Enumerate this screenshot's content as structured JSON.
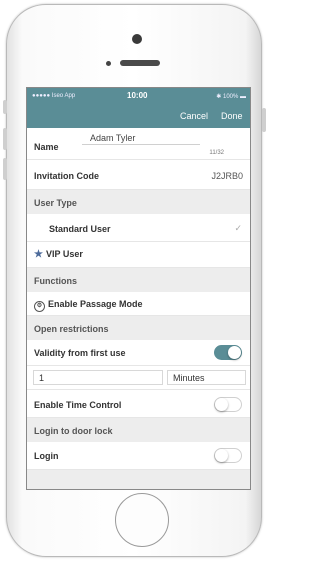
{
  "status_bar": {
    "carrier": "●●●●● Iseo App",
    "time": "10:00",
    "battery": "✱ 100% ▬"
  },
  "navbar": {
    "cancel": "Cancel",
    "done": "Done"
  },
  "name": {
    "label": "Name",
    "value": "Adam Tyler",
    "counter": "11/32"
  },
  "invitation": {
    "label": "Invitation Code",
    "value": "J2JRB0"
  },
  "user_type": {
    "header": "User Type",
    "standard": "Standard User",
    "check": "✓",
    "vip": "VIP User"
  },
  "functions": {
    "header": "Functions",
    "passage_mode": "Enable Passage Mode"
  },
  "open_restrictions": {
    "header": "Open restrictions",
    "validity_label": "Validity from first use",
    "validity_on": true,
    "duration_value": "1",
    "duration_unit": "Minutes",
    "time_control_label": "Enable Time Control",
    "time_control_on": false
  },
  "door_lock": {
    "header": "Login to door lock",
    "login_label": "Login",
    "login_on": false
  },
  "colors": {
    "accent": "#5a8d96"
  }
}
